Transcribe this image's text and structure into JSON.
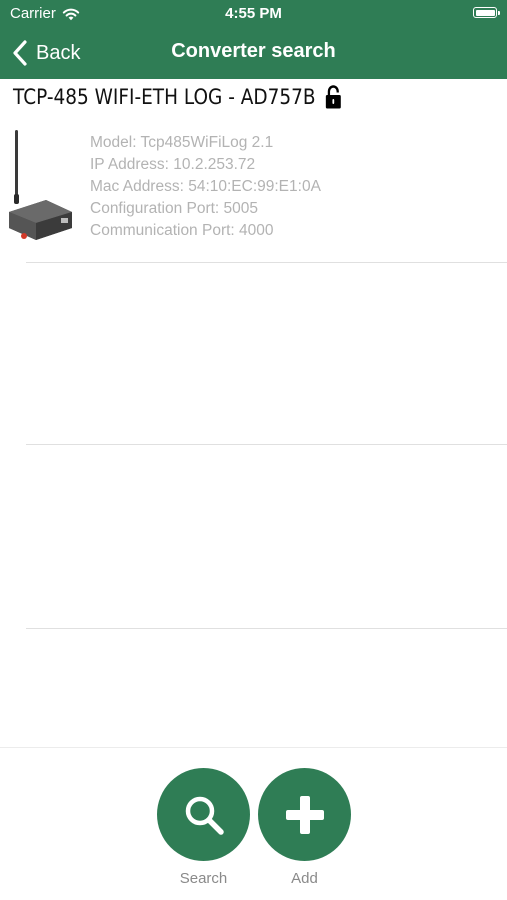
{
  "status_bar": {
    "carrier": "Carrier",
    "time": "4:55 PM"
  },
  "nav": {
    "back_label": "Back",
    "title": "Converter search"
  },
  "device": {
    "title": "TCP-485 WIFI-ETH LOG - AD757B",
    "model": "Model: Tcp485WiFiLog 2.1",
    "ip": "IP Address: 10.2.253.72",
    "mac": "Mac Address: 54:10:EC:99:E1:0A",
    "config_port": "Configuration Port: 5005",
    "comm_port": "Communication Port: 4000"
  },
  "actions": {
    "search_label": "Search",
    "add_label": "Add"
  },
  "colors": {
    "brand_green": "#2f7d55",
    "info_text": "#b3b3b3",
    "label_text": "#8a8a8a"
  },
  "icons": [
    "wifi-icon",
    "battery-icon",
    "back-chevron-icon",
    "lock-icon",
    "search-icon",
    "plus-icon"
  ]
}
